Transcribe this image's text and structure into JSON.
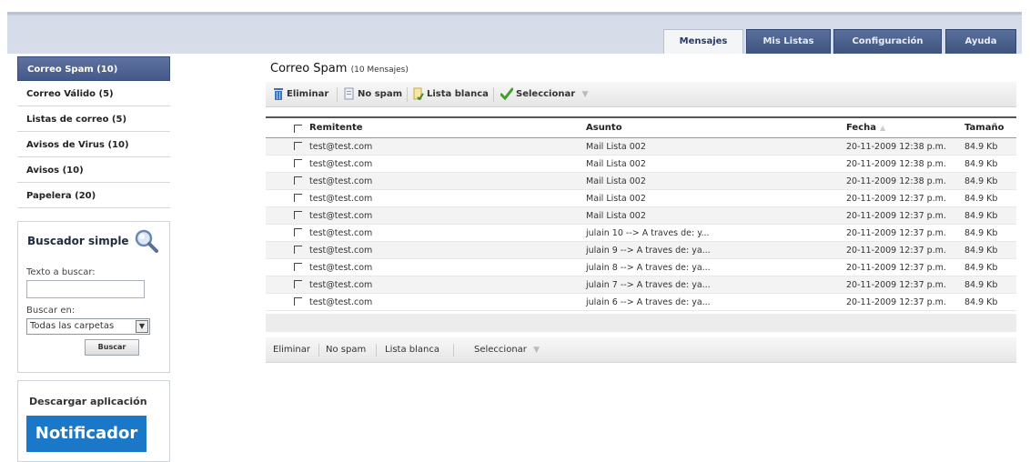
{
  "tabs": [
    {
      "label": "Mensajes",
      "active": true
    },
    {
      "label": "Mis Listas",
      "active": false
    },
    {
      "label": "Configuración",
      "active": false
    },
    {
      "label": "Ayuda",
      "active": false
    }
  ],
  "sidebar": {
    "items": [
      {
        "label": "Correo Spam (10)",
        "active": true
      },
      {
        "label": "Correo Válido (5)"
      },
      {
        "label": "Listas de correo (5)"
      },
      {
        "label": "Avisos de Virus (10)"
      },
      {
        "label": "Avisos (10)"
      },
      {
        "label": "Papelera (20)"
      }
    ],
    "search": {
      "title": "Buscador simple",
      "text_label": "Texto a buscar:",
      "text_value": "",
      "folder_label": "Buscar en:",
      "folder_value": "Todas las carpetas",
      "button": "Buscar"
    },
    "download": {
      "title": "Descargar aplicación",
      "app_name": "Notificador"
    }
  },
  "main": {
    "title": "Correo Spam",
    "subtitle": "(10 Mensajes)",
    "toolbar": {
      "delete": "Eliminar",
      "nospam": "No spam",
      "whitelist": "Lista blanca",
      "select": "Seleccionar"
    },
    "columns": {
      "from": "Remitente",
      "subject": "Asunto",
      "date": "Fecha",
      "size": "Tamaño"
    },
    "rows": [
      {
        "from": "test@test.com",
        "subject": "Mail Lista 002",
        "date": "20-11-2009 12:38 p.m.",
        "size": "84.9 Kb"
      },
      {
        "from": "test@test.com",
        "subject": "Mail Lista 002",
        "date": "20-11-2009 12:38 p.m.",
        "size": "84.9 Kb"
      },
      {
        "from": "test@test.com",
        "subject": "Mail Lista 002",
        "date": "20-11-2009 12:38 p.m.",
        "size": "84.9 Kb"
      },
      {
        "from": "test@test.com",
        "subject": "Mail Lista 002",
        "date": "20-11-2009 12:37 p.m.",
        "size": "84.9 Kb"
      },
      {
        "from": "test@test.com",
        "subject": "Mail Lista 002",
        "date": "20-11-2009 12:37 p.m.",
        "size": "84.9 Kb"
      },
      {
        "from": "test@test.com",
        "subject": "julain 10 --> A traves de: y...",
        "date": "20-11-2009 12:37 p.m.",
        "size": "84.9 Kb"
      },
      {
        "from": "test@test.com",
        "subject": "julain 9 --> A traves de: ya...",
        "date": "20-11-2009 12:37 p.m.",
        "size": "84.9 Kb"
      },
      {
        "from": "test@test.com",
        "subject": "julain 8 --> A traves de: ya...",
        "date": "20-11-2009 12:37 p.m.",
        "size": "84.9 Kb"
      },
      {
        "from": "test@test.com",
        "subject": "julain 7 --> A traves de: ya...",
        "date": "20-11-2009 12:37 p.m.",
        "size": "84.9 Kb"
      },
      {
        "from": "test@test.com",
        "subject": "julain 6 --> A traves de: ya...",
        "date": "20-11-2009 12:37 p.m.",
        "size": "84.9 Kb"
      }
    ],
    "bottom_toolbar": {
      "delete": "Eliminar",
      "nospam": "No spam",
      "whitelist": "Lista blanca",
      "select": "Seleccionar"
    }
  },
  "colors": {
    "active_nav": "#4d6292",
    "dark_tab": "#465c87",
    "app_blue": "#1b78c8"
  }
}
